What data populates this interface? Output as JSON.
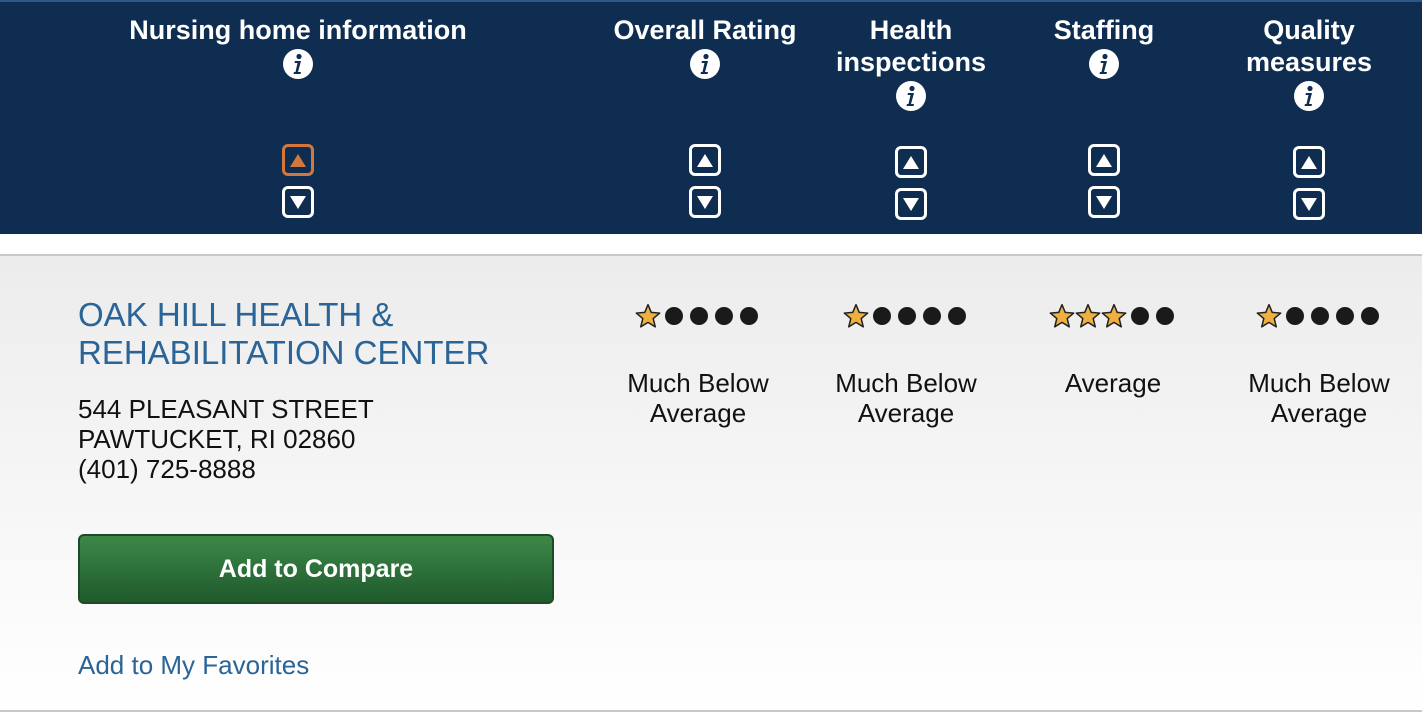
{
  "header": {
    "columns": [
      {
        "title": "Nursing home information",
        "sort_up_active": true
      },
      {
        "title": "Overall Rating"
      },
      {
        "title": "Health inspections"
      },
      {
        "title": "Staffing"
      },
      {
        "title": "Quality measures"
      }
    ]
  },
  "facility": {
    "name": "OAK HILL HEALTH & REHABILITATION CENTER",
    "address_line1": "544 PLEASANT STREET",
    "address_line2": "PAWTUCKET, RI 02860",
    "phone": "(401) 725-8888",
    "compare_label": "Add to Compare",
    "favorites_label": "Add to My Favorites",
    "ratings": [
      {
        "category": "Overall Rating",
        "stars": 1,
        "max": 5,
        "text": "Much Below Average"
      },
      {
        "category": "Health inspections",
        "stars": 1,
        "max": 5,
        "text": "Much Below Average"
      },
      {
        "category": "Staffing",
        "stars": 3,
        "max": 5,
        "text": "Average"
      },
      {
        "category": "Quality measures",
        "stars": 1,
        "max": 5,
        "text": "Much Below Average"
      }
    ]
  },
  "colors": {
    "header_bg": "#0f2d50",
    "link": "#2b6496",
    "active_sort": "#d4773d",
    "star": "#f0b040",
    "button": "#2e7a3c"
  },
  "icons": [
    "info-icon",
    "sort-ascending-icon",
    "sort-descending-icon",
    "star-icon",
    "empty-rating-dot-icon"
  ]
}
